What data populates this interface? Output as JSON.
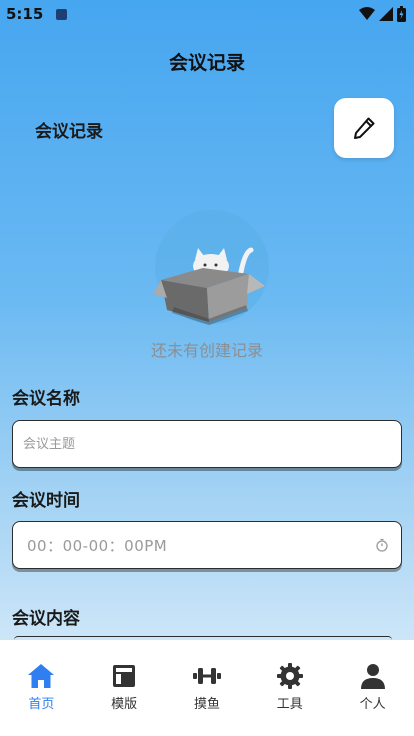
{
  "status_bar": {
    "time": "5:15"
  },
  "header": {
    "title": "会议记录"
  },
  "records": {
    "section_title": "会议记录",
    "empty_text": "还未有创建记录"
  },
  "form": {
    "name_label": "会议名称",
    "name_placeholder": "会议主题",
    "time_label": "会议时间",
    "time_value": "00：00-00：00PM",
    "content_label": "会议内容"
  },
  "tabs": [
    {
      "label": "首页",
      "icon": "home-icon",
      "active": true
    },
    {
      "label": "模版",
      "icon": "template-icon",
      "active": false
    },
    {
      "label": "摸鱼",
      "icon": "dumbbell-icon",
      "active": false
    },
    {
      "label": "工具",
      "icon": "gear-icon",
      "active": false
    },
    {
      "label": "个人",
      "icon": "person-icon",
      "active": false
    }
  ],
  "colors": {
    "accent": "#2f7ff0",
    "background_top": "#46a6f0",
    "inactive_icon": "#333333"
  }
}
